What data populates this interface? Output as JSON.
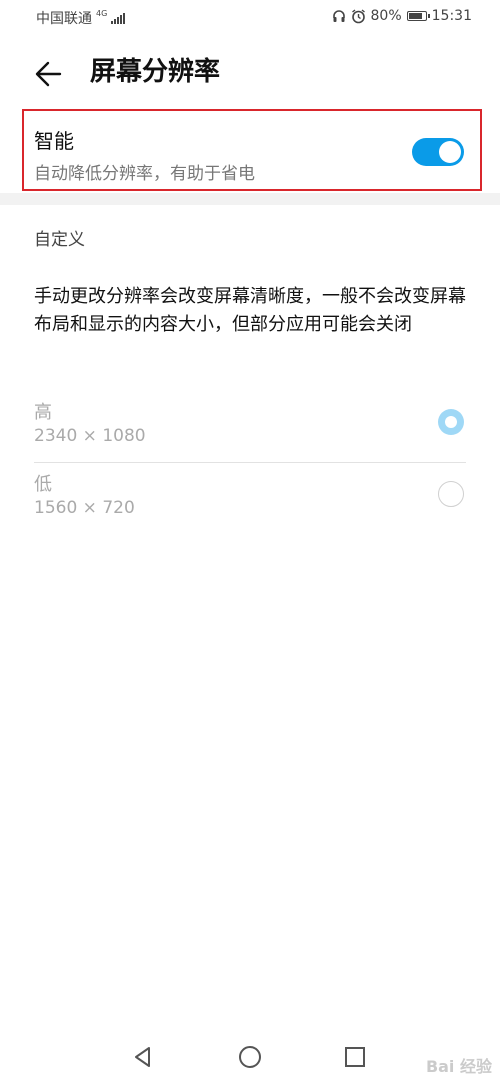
{
  "status_bar": {
    "carrier": "中国联通",
    "network_type": "4G",
    "battery_level": "80%",
    "time": "15:31",
    "icons": [
      "headset-icon",
      "alarm-icon",
      "battery-icon",
      "signal-icon"
    ]
  },
  "header": {
    "title": "屏幕分辨率",
    "back_icon": "back-arrow-icon"
  },
  "smart": {
    "title": "智能",
    "description": "自动降低分辨率，有助于省电",
    "toggle_on": true,
    "accent_color": "#0a9be8",
    "highlight_color": "#d9262c"
  },
  "custom": {
    "section_label": "自定义",
    "explanation": "手动更改分辨率会改变屏幕清晰度，一般不会改变屏幕布局和显示的内容大小，但部分应用可能会关闭",
    "options": [
      {
        "name": "高",
        "resolution": "2340 × 1080",
        "selected": true
      },
      {
        "name": "低",
        "resolution": "1560 × 720",
        "selected": false
      }
    ]
  },
  "nav_bar": {
    "icons": [
      "nav-back-icon",
      "nav-home-icon",
      "nav-recent-icon"
    ]
  },
  "watermark": {
    "text": "Bai 经验"
  }
}
